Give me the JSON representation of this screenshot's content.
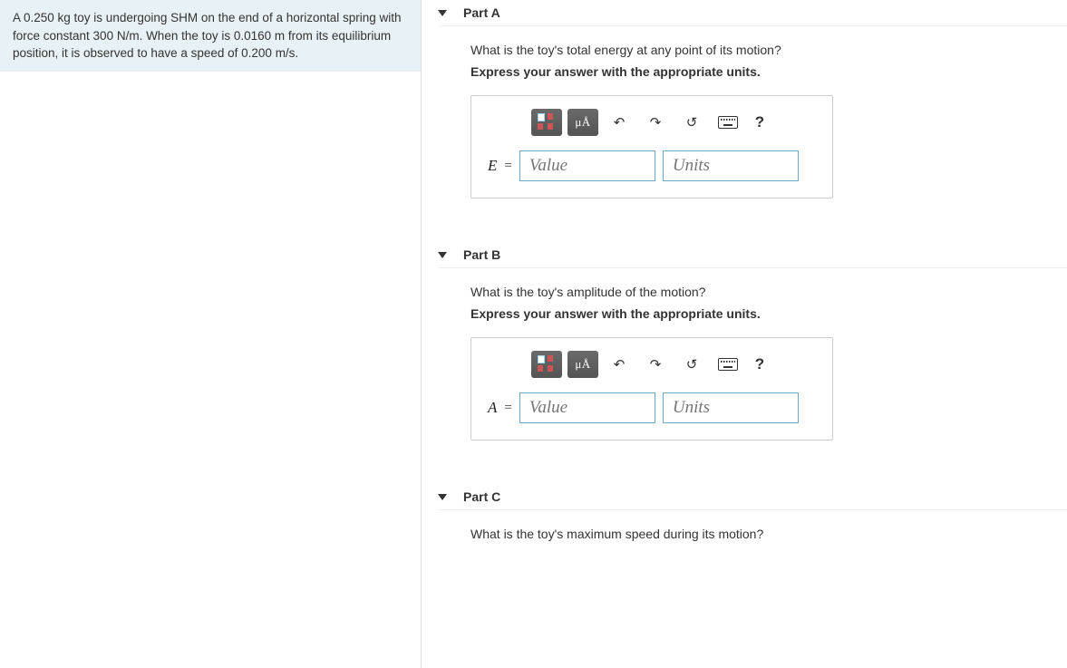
{
  "problem": {
    "text_html": "A 0.250 kg toy is undergoing SHM on the end of a horizontal spring with force constant 300 N/m. When the toy is 0.0160 m from its equilibrium position, it is observed to have a speed of 0.200 m/s."
  },
  "parts": {
    "a": {
      "title": "Part A",
      "question": "What is the toy's total energy at any point of its motion?",
      "instruction": "Express your answer with the appropriate units.",
      "variable": "E",
      "value_placeholder": "Value",
      "units_placeholder": "Units"
    },
    "b": {
      "title": "Part B",
      "question": "What is the toy's amplitude of the motion?",
      "instruction": "Express your answer with the appropriate units.",
      "variable": "A",
      "value_placeholder": "Value",
      "units_placeholder": "Units"
    },
    "c": {
      "title": "Part C",
      "question": "What is the toy's maximum speed during its motion?"
    }
  },
  "toolbar": {
    "mua_label": "μÅ",
    "help_label": "?"
  }
}
